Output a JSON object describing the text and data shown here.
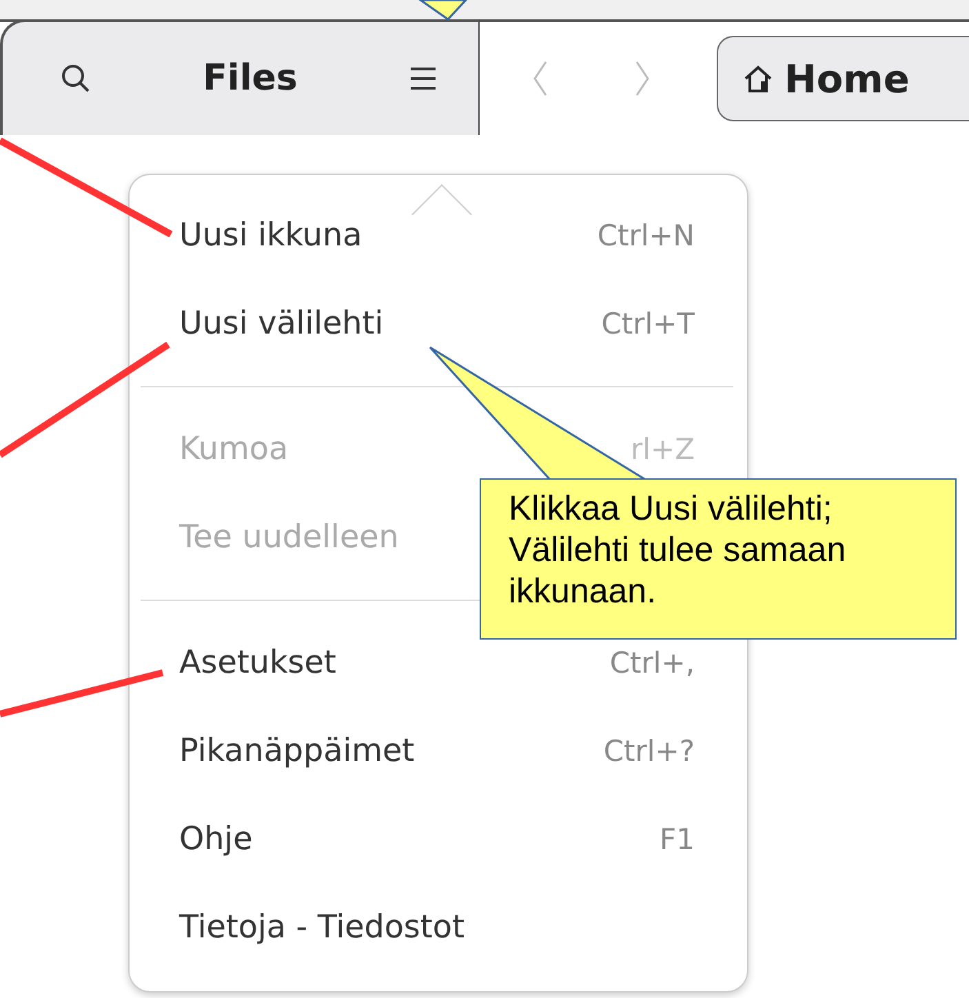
{
  "header": {
    "title": "Files",
    "home_button": "Home"
  },
  "menu": [
    {
      "kind": "item",
      "label": "Uusi ikkuna",
      "shortcut": "Ctrl+N",
      "disabled": false
    },
    {
      "kind": "item",
      "label": "Uusi välilehti",
      "shortcut": "Ctrl+T",
      "disabled": false
    },
    {
      "kind": "separator"
    },
    {
      "kind": "item",
      "label": "Kumoa",
      "shortcut": "rl+Z",
      "disabled": true
    },
    {
      "kind": "item",
      "label": "Tee uudelleen",
      "disabled": true
    },
    {
      "kind": "separator"
    },
    {
      "kind": "item",
      "label": "Asetukset",
      "shortcut": "Ctrl+,",
      "disabled": false
    },
    {
      "kind": "item",
      "label": "Pikanäppäimet",
      "shortcut": "Ctrl+?",
      "disabled": false
    },
    {
      "kind": "item",
      "label": "Ohje",
      "shortcut": "F1",
      "disabled": false
    },
    {
      "kind": "item",
      "label": "Tietoja - Tiedostot",
      "disabled": false
    }
  ],
  "callout": {
    "text": "Klikkaa Uusi välilehti;\nVälilehti tulee samaan\nikkunaan."
  }
}
